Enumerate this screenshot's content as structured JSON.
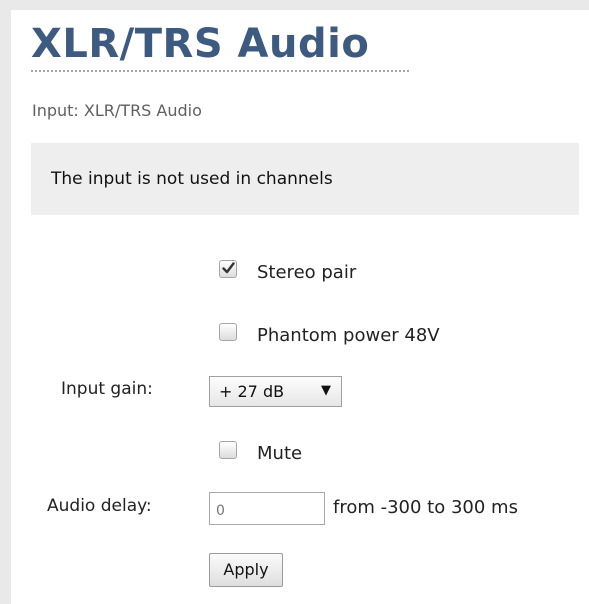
{
  "page": {
    "title": "XLR/TRS Audio",
    "subtitle": "Input: XLR/TRS Audio",
    "notice": "The input is not used in channels"
  },
  "options": {
    "stereo_pair": {
      "label": "Stereo pair",
      "checked": true
    },
    "phantom_power": {
      "label": "Phantom power 48V",
      "checked": false
    },
    "mute": {
      "label": "Mute",
      "checked": false
    }
  },
  "input_gain": {
    "label": "Input gain:",
    "value": "+ 27 dB",
    "arrow": "▼"
  },
  "audio_delay": {
    "label": "Audio delay:",
    "value": "0",
    "range_hint": "from -300 to 300 ms"
  },
  "actions": {
    "apply_label": "Apply"
  },
  "colors": {
    "title": "#3d5a80",
    "notice_bg": "#eeeeee",
    "page_bg": "#e9e9e9"
  },
  "icons": {
    "checkmark": "checkmark-icon",
    "dropdown": "triangle-down-icon"
  }
}
